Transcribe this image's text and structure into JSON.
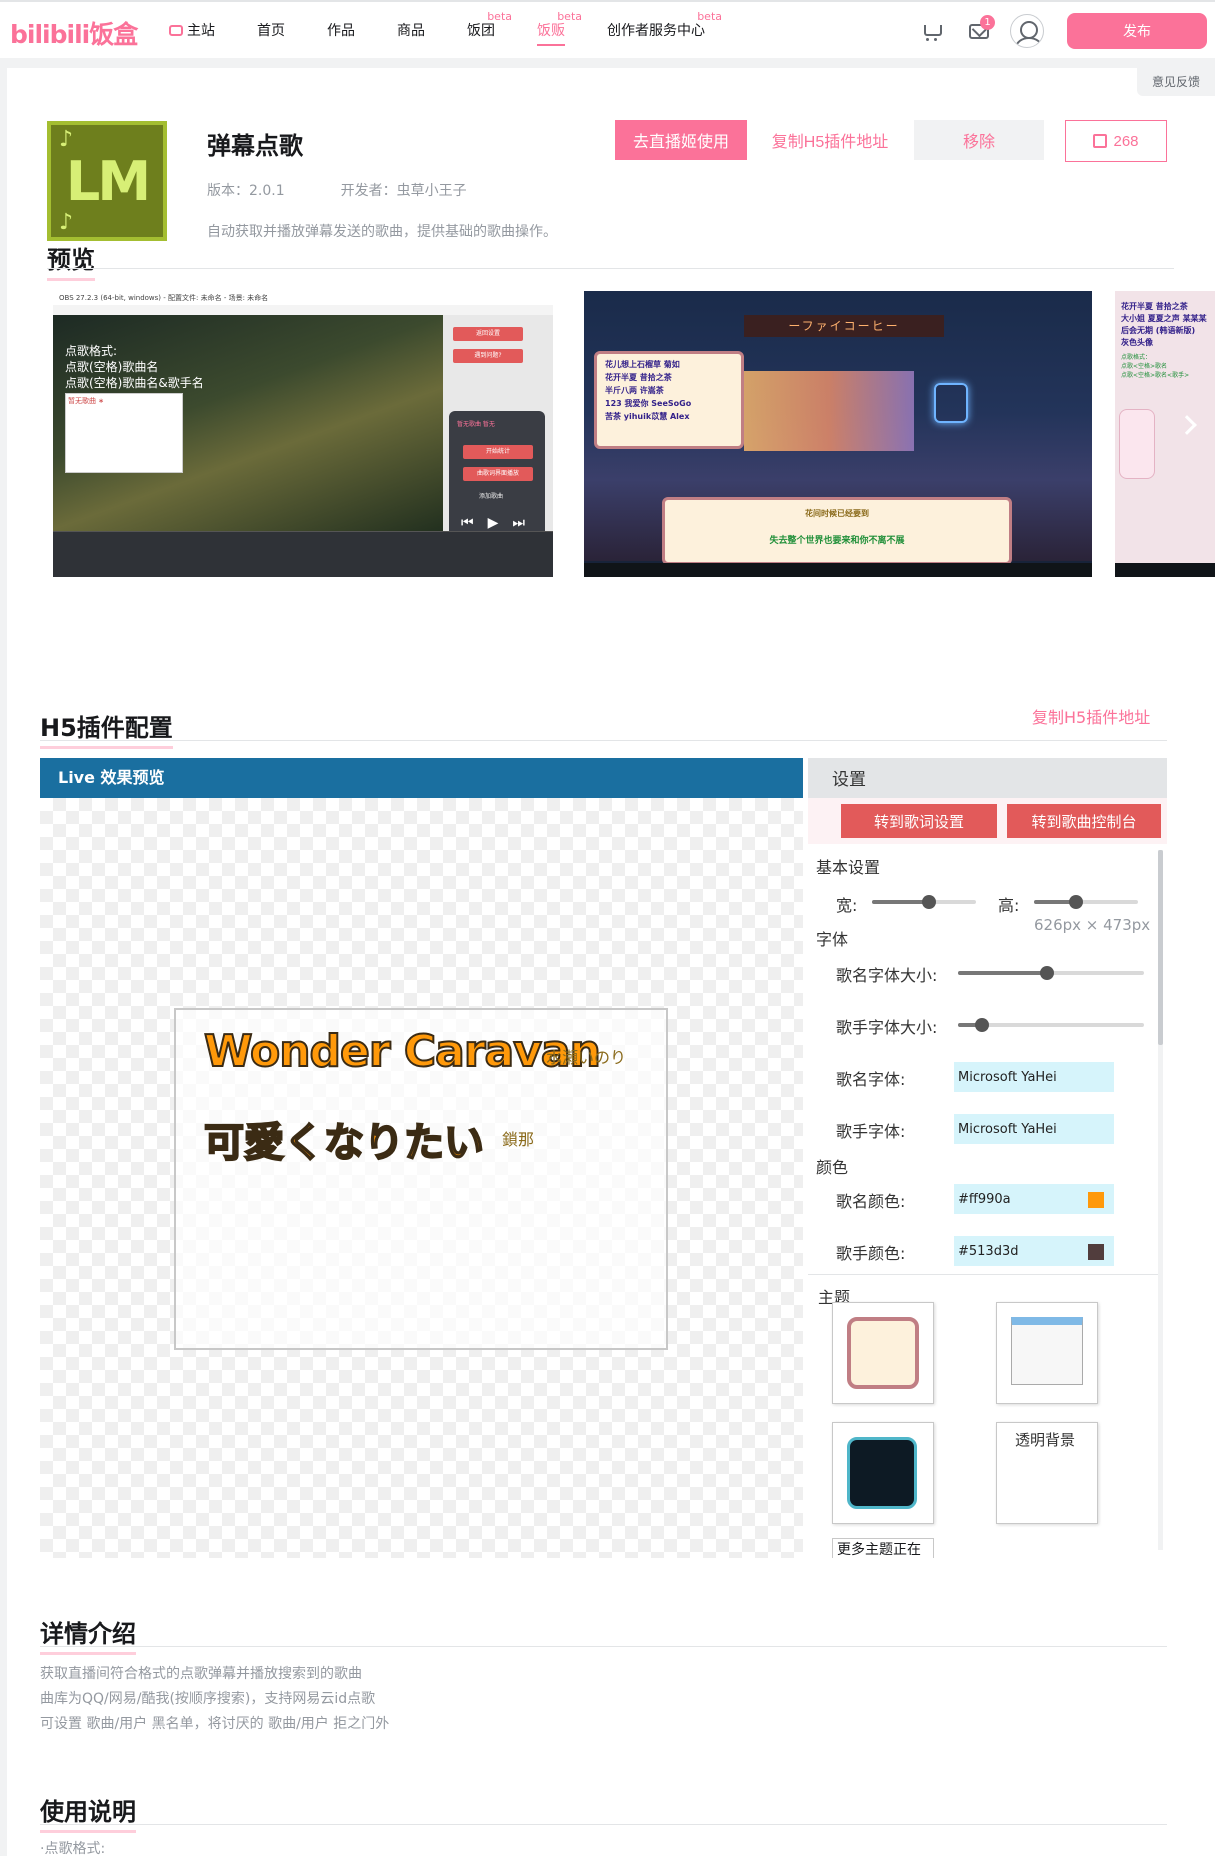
{
  "brand": {
    "logo": "bilibili饭盒",
    "accent": "#fb7299"
  },
  "nav": {
    "items": [
      {
        "label": "主站",
        "beta": ""
      },
      {
        "label": "首页",
        "beta": ""
      },
      {
        "label": "作品",
        "beta": ""
      },
      {
        "label": "商品",
        "beta": ""
      },
      {
        "label": "饭团",
        "beta": "beta"
      },
      {
        "label": "饭贩",
        "beta": "beta"
      },
      {
        "label": "创作者服务中心",
        "beta": "beta"
      }
    ],
    "active_index": 5,
    "message_badge": "1",
    "publish_label": "发布",
    "icons": [
      "tv-icon",
      "cart-icon",
      "mail-icon",
      "avatar-icon"
    ]
  },
  "feedback_label": "意见反馈",
  "plugin": {
    "icon_text": "LM",
    "title": "弹幕点歌",
    "version": "版本：2.0.1",
    "developer": "开发者：虫草小王子",
    "description": "自动获取并播放弹幕发送的歌曲，提供基础的歌曲操作。",
    "use_button": "去直播姬使用",
    "copy_button": "复制H5插件地址",
    "remove_button": "移除",
    "likes": "268"
  },
  "preview": {
    "title": "预览",
    "shot1": {
      "window_title": "OBS 27.2.3 (64-bit, windows) - 配置文件: 未命名 - 场景: 未命名",
      "overlay_lines": [
        "点歌格式:",
        "点歌(空格)歌曲名",
        "点歌(空格)歌曲名&歌手名"
      ],
      "box_text": "暂无歌曲 ∗",
      "panel_buttons": [
        "返回设置",
        "遇到问题?"
      ],
      "player_lines": [
        "暂无歌曲 暂无",
        "开始统计",
        "曲歌词界面播放",
        "添加歌曲"
      ]
    },
    "shot2": {
      "sign": "ーファイコーヒー",
      "list": [
        "花儿想上石榴草 菊如",
        "花开半夏 昔拾之茶",
        "半斤八两 许嵩茶",
        "123 我爱你 SeeSoGo",
        "苦茶 yihuik苡慧 Alex"
      ],
      "playing_title": "花间时候已经要到",
      "playing_line": "失去整个世界也要来和你不离不展"
    },
    "shot3": {
      "list": [
        "花开半夏 昔拾之茶",
        "大小姐 夏夏之声 某某某",
        "后会无期 (韩语新版)",
        "灰色头像"
      ],
      "list2": [
        "点歌格式：",
        "点歌<空格>歌名",
        "点歌<空格>歌名<歌手>"
      ]
    }
  },
  "h5": {
    "title": "H5插件配置",
    "copy_link": "复制H5插件地址",
    "live_header": "Live 效果预览",
    "song1": {
      "name": "Wonder Caravan",
      "artist": "水瀬いのり"
    },
    "song2": {
      "name": "可愛くなりたい",
      "artist": "鎖那"
    },
    "settings": {
      "header": "设置",
      "btn_lyrics": "转到歌词设置",
      "btn_console": "转到歌曲控制台",
      "basic": "基本设置",
      "width_label": "宽:",
      "height_label": "高:",
      "width_value": 0.55,
      "height_value": 0.4,
      "dims": "626px × 473px",
      "font_group": "字体",
      "name_size_label": "歌名字体大小:",
      "artist_size_label": "歌手字体大小:",
      "name_size_value": 0.48,
      "artist_size_value": 0.13,
      "name_font_label": "歌名字体:",
      "artist_font_label": "歌手字体:",
      "name_font": "Microsoft YaHei",
      "artist_font": "Microsoft YaHei",
      "color_group": "颜色",
      "name_color_label": "歌名颜色:",
      "artist_color_label": "歌手颜色:",
      "name_color": "#ff990a",
      "artist_color": "#513d3d",
      "theme_group": "主题",
      "theme_transparent": "透明背景",
      "more_themes": "更多主题正在"
    }
  },
  "details": {
    "title": "详情介绍",
    "lines": [
      "获取直播间符合格式的点歌弹幕并播放搜索到的歌曲",
      "曲库为QQ/网易/酷我(按顺序搜索)，支持网易云id点歌",
      "可设置 歌曲/用户 黑名单，将讨厌的 歌曲/用户 拒之门外"
    ]
  },
  "usage": {
    "title": "使用说明",
    "first_line": "·点歌格式:"
  }
}
